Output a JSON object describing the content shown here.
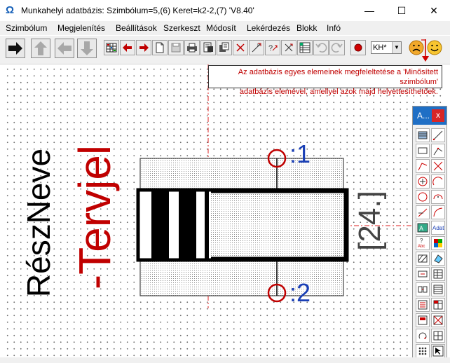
{
  "window": {
    "title": "Munkahelyi adatbázis: Szimbólum=5,(6) Keret=k2-2,(7) 'V8.40'",
    "app_icon": "omega-icon",
    "minimize_glyph": "—",
    "maximize_glyph": "☐",
    "close_glyph": "✕"
  },
  "menu": [
    {
      "label": "Szimbólum"
    },
    {
      "label": "Megjelenítés"
    },
    {
      "label": "Beállítások"
    },
    {
      "label": "Szerkeszt"
    },
    {
      "label": "Módosít"
    },
    {
      "label": "Lekérdezés"
    },
    {
      "label": "Blokk"
    },
    {
      "label": "Infó"
    }
  ],
  "toolbar": {
    "layer_select": "KH*",
    "icons": [
      "arrow-right-icon",
      "arrow-up-icon",
      "arrow-left-icon",
      "arrow-down-icon",
      "grid-icon",
      "red-arrow-left-icon",
      "red-arrow-right-icon",
      "new-page-icon",
      "save-icon",
      "print-icon",
      "export-icon",
      "copy-icon",
      "delete-icon",
      "move-point-icon",
      "query-icon",
      "move-icon",
      "table-icon",
      "undo-icon",
      "redo-icon",
      "stop-icon",
      "sad-face-icon",
      "smiley-face-icon"
    ]
  },
  "tooltip": {
    "line1": "Az adatbázis egyes elemeinek megfeleltetése a 'Minősített szimbólum'",
    "line2": "adatbázis elemével, amellyel azok majd helyettesíthetőek."
  },
  "drawing": {
    "part_name": "RészNeve",
    "designator": "-Tervjel",
    "pin1": ":1",
    "pin2": ":2",
    "value": "[24.]",
    "colors": {
      "designator": "#c00000",
      "pin_label": "#1a3fb5",
      "pin_circle": "#c00000",
      "guide": "#c00000",
      "body": "#000000"
    }
  },
  "palette": {
    "title": "A...",
    "close": "x",
    "buttons": [
      "rect-shade-icon",
      "line-icon",
      "rectangle-icon",
      "angle-icon",
      "polyline-icon",
      "cross-icon",
      "circle-plus-icon",
      "arc-icon",
      "circle-icon",
      "arc-point-icon",
      "ray-icon",
      "arc-ray-icon",
      "text-box-icon",
      "adat-text-icon",
      "question-text-icon",
      "color-grid-icon",
      "hatch-icon",
      "fill-shape-icon",
      "insert-icon",
      "table-icon",
      "connect-icon",
      "table2-icon",
      "list-icon",
      "table3-icon",
      "block-icon",
      "cross-box-icon",
      "rotate-icon",
      "table4-icon",
      "dots-icon",
      "pointer-icon"
    ],
    "adat_label": "Adat"
  }
}
